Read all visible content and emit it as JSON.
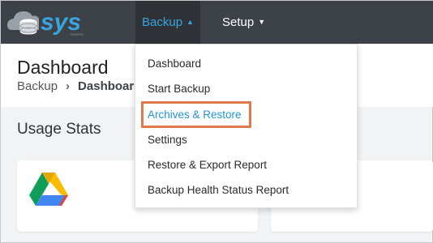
{
  "app": {
    "logo_text": "sys"
  },
  "nav": {
    "backup_label": "Backup",
    "setup_label": "Setup",
    "caret_up": "▲",
    "caret_down": "▼"
  },
  "header": {
    "title": "Dashboard",
    "breadcrumb": {
      "parent": "Backup",
      "separator": "›",
      "current": "Dashboard"
    }
  },
  "main": {
    "section_title": "Usage Stats"
  },
  "dropdown": {
    "items": [
      {
        "label": "Dashboard"
      },
      {
        "label": "Start Backup"
      },
      {
        "label": "Archives & Restore"
      },
      {
        "label": "Settings"
      },
      {
        "label": "Restore & Export Report"
      },
      {
        "label": "Backup Health Status Report"
      }
    ],
    "active_index": 2
  },
  "colors": {
    "topbar": "#3d4148",
    "accent": "#36a6dd",
    "highlight_border": "#e07a4a"
  },
  "icons": {
    "logo": "sys-logo-icon",
    "card": "google-drive-icon"
  }
}
